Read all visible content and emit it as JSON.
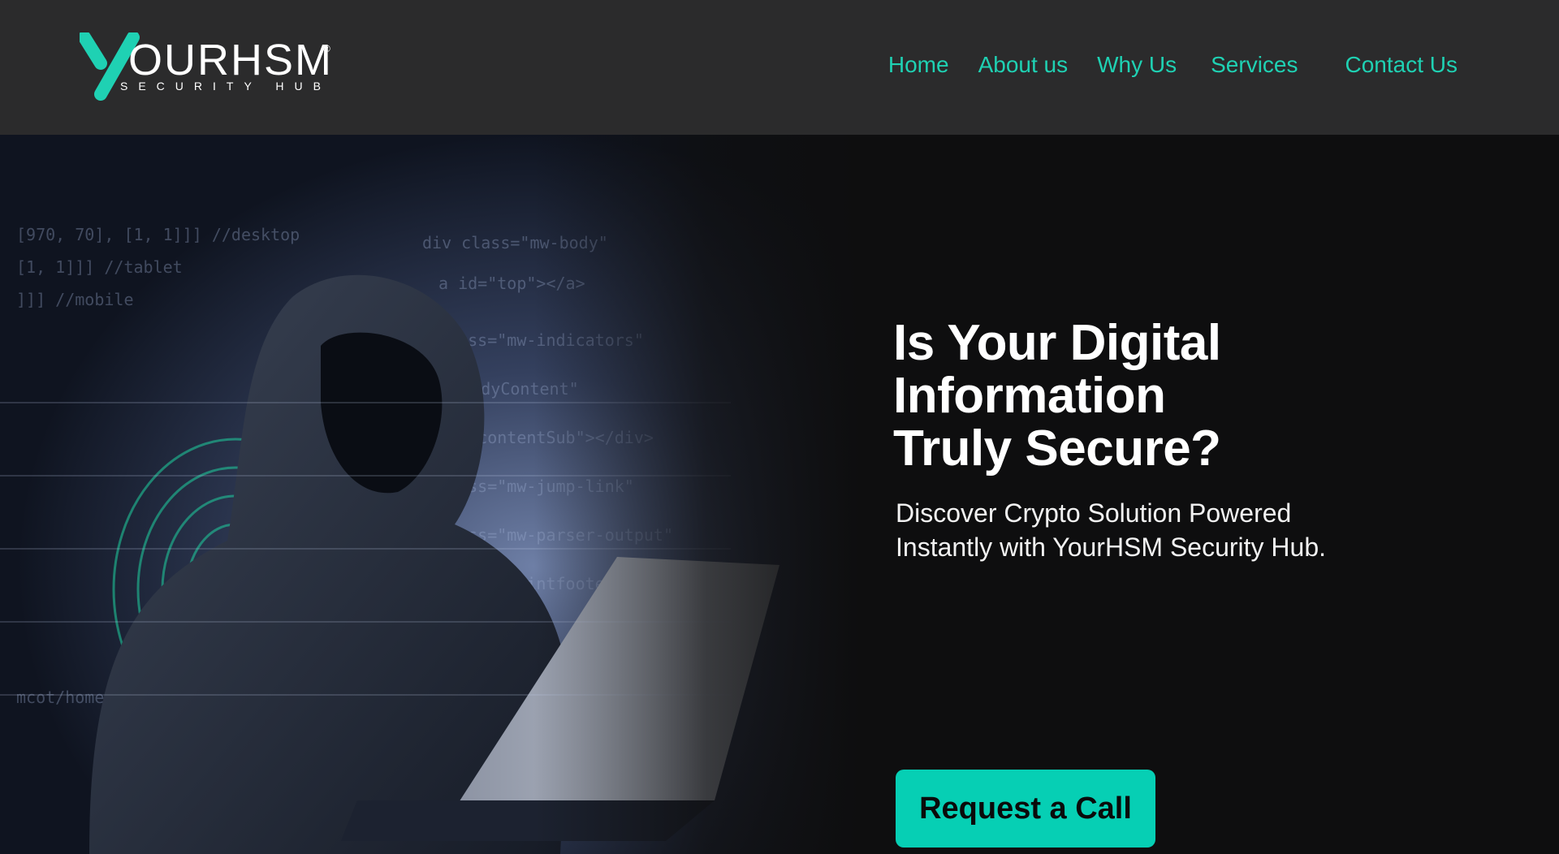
{
  "brand": {
    "logo_text": "YOURHSM",
    "logo_tagline": "SECURITY HUB",
    "registered_mark": "®",
    "accent_color": "#06cfb4",
    "nav_color": "#1fd1b3",
    "header_bg": "#2b2b2c",
    "hero_bg": "#0e0e0f"
  },
  "nav": {
    "items": [
      {
        "label": "Home"
      },
      {
        "label": "About us"
      },
      {
        "label": "Why Us"
      },
      {
        "label": "Services"
      },
      {
        "label": "Contact Us"
      }
    ]
  },
  "hero": {
    "headline_lines": [
      "Is Your Digital",
      "Information",
      "Truly Secure?"
    ],
    "subline_lines": [
      "Discover Crypto Solution Powered",
      "Instantly with YourHSM Security Hub."
    ],
    "cta_label": "Request a Call",
    "image_subject": "hooded-hacker-with-laptop"
  }
}
